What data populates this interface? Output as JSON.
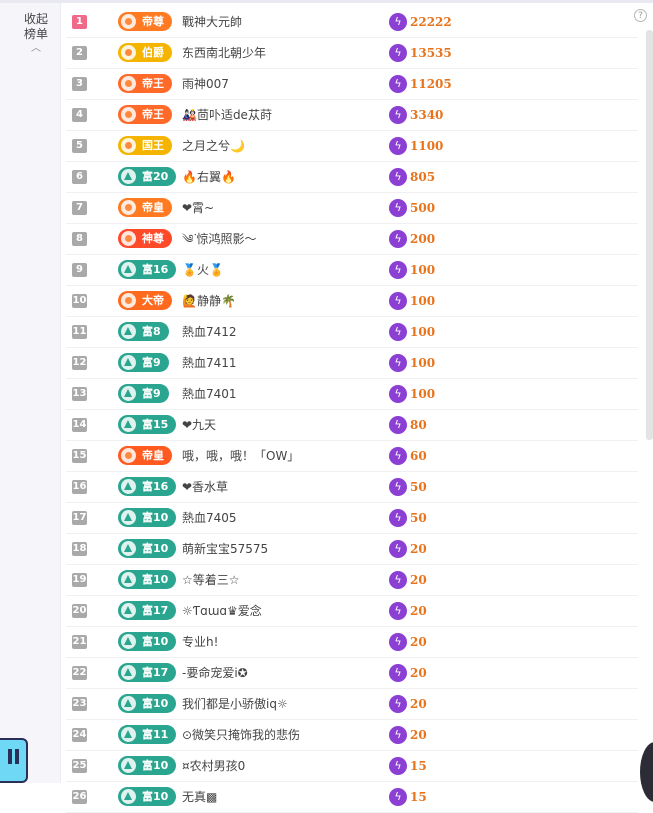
{
  "collapse": {
    "label_line1": "收起",
    "label_line2": "榜单",
    "chevron": "chevron-up-icon"
  },
  "help": {
    "glyph": "?"
  },
  "colors": {
    "wealth": "#2aa590",
    "noble": "#ff7a21",
    "gold": "#ffb400",
    "emperor": "#ff5a1f",
    "bolt": "#8b3fd3",
    "score": "#e8731b",
    "rank_top": "#f06b8a",
    "rank": "#a9a9a9"
  },
  "rows": [
    {
      "rank": "1",
      "badge": "帝尊",
      "badge_type": "noble",
      "badge_color": "#ff7a21",
      "name": "戰神大元帥",
      "score": "22222"
    },
    {
      "rank": "2",
      "badge": "伯爵",
      "badge_type": "noble",
      "badge_color": "#f5b400",
      "name": "东西南北朝少年",
      "score": "13535"
    },
    {
      "rank": "3",
      "badge": "帝王",
      "badge_type": "noble",
      "badge_color": "#ff6a2a",
      "name": "雨神007",
      "score": "11205"
    },
    {
      "rank": "4",
      "badge": "帝王",
      "badge_type": "noble",
      "badge_color": "#ff6a2a",
      "name": "🎎茴卟适de苁莳",
      "score": "3340"
    },
    {
      "rank": "5",
      "badge": "国王",
      "badge_type": "noble",
      "badge_color": "#f5b400",
      "name": "之月之兮🌙",
      "score": "1100"
    },
    {
      "rank": "6",
      "badge": "富20",
      "badge_type": "wealth",
      "badge_color": "#2aa590",
      "name": "🔥右翼🔥",
      "score": "805"
    },
    {
      "rank": "7",
      "badge": "帝皇",
      "badge_type": "noble",
      "badge_color": "#ff7a21",
      "name": "❤霄~",
      "score": "500"
    },
    {
      "rank": "8",
      "badge": "神尊",
      "badge_type": "noble",
      "badge_color": "#ff4a2a",
      "name": "༄ᐝ惊鸿照影～",
      "score": "200"
    },
    {
      "rank": "9",
      "badge": "富16",
      "badge_type": "wealth",
      "badge_color": "#2aa590",
      "name": "🏅火🏅",
      "score": "100"
    },
    {
      "rank": "10",
      "badge": "大帝",
      "badge_type": "noble",
      "badge_color": "#ff6a1f",
      "name": "🙋静静🌴",
      "score": "100"
    },
    {
      "rank": "11",
      "badge": "富8",
      "badge_type": "wealth",
      "badge_color": "#2aa590",
      "name": "熱血7412",
      "score": "100"
    },
    {
      "rank": "12",
      "badge": "富9",
      "badge_type": "wealth",
      "badge_color": "#2aa590",
      "name": "熱血7411",
      "score": "100"
    },
    {
      "rank": "13",
      "badge": "富9",
      "badge_type": "wealth",
      "badge_color": "#2aa590",
      "name": "熱血7401",
      "score": "100"
    },
    {
      "rank": "14",
      "badge": "富15",
      "badge_type": "wealth",
      "badge_color": "#2aa590",
      "name": "❤九天",
      "score": "80"
    },
    {
      "rank": "15",
      "badge": "帝皇",
      "badge_type": "noble",
      "badge_color": "#ff5a1f",
      "name": "哦，哦，哦！「OW」",
      "score": "60"
    },
    {
      "rank": "16",
      "badge": "富16",
      "badge_type": "wealth",
      "badge_color": "#2aa590",
      "name": "❤香水草",
      "score": "50"
    },
    {
      "rank": "17",
      "badge": "富10",
      "badge_type": "wealth",
      "badge_color": "#2aa590",
      "name": "熱血7405",
      "score": "50"
    },
    {
      "rank": "18",
      "badge": "富10",
      "badge_type": "wealth",
      "badge_color": "#2aa590",
      "name": "萌新宝宝57575",
      "score": "20"
    },
    {
      "rank": "19",
      "badge": "富10",
      "badge_type": "wealth",
      "badge_color": "#2aa590",
      "name": "☆等着三☆",
      "score": "20"
    },
    {
      "rank": "20",
      "badge": "富17",
      "badge_type": "wealth",
      "badge_color": "#2aa590",
      "name": "☼Ƭɑɯɑ♛爱念",
      "score": "20"
    },
    {
      "rank": "21",
      "badge": "富10",
      "badge_type": "wealth",
      "badge_color": "#2aa590",
      "name": "专业h!",
      "score": "20"
    },
    {
      "rank": "22",
      "badge": "富17",
      "badge_type": "wealth",
      "badge_color": "#2aa590",
      "name": "-要命宠爱i✪",
      "score": "20"
    },
    {
      "rank": "23",
      "badge": "富10",
      "badge_type": "wealth",
      "badge_color": "#2aa590",
      "name": "我们都是小骄傲iq☼",
      "score": "20"
    },
    {
      "rank": "24",
      "badge": "富11",
      "badge_type": "wealth",
      "badge_color": "#2aa590",
      "name": "⊙微笑只掩饰我的悲伤",
      "score": "20"
    },
    {
      "rank": "25",
      "badge": "富10",
      "badge_type": "wealth",
      "badge_color": "#2aa590",
      "name": "¤农村男孩0",
      "score": "15"
    },
    {
      "rank": "26",
      "badge": "富10",
      "badge_type": "wealth",
      "badge_color": "#2aa590",
      "name": "无真▩",
      "score": "15"
    }
  ]
}
